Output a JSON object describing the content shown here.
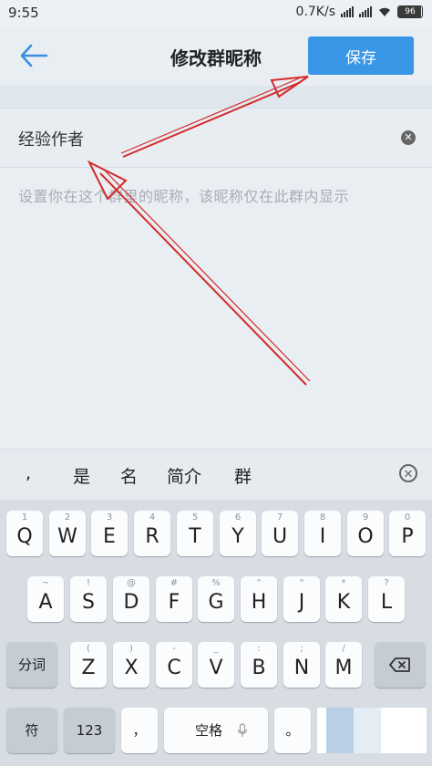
{
  "status_bar": {
    "time": "9:55",
    "network_speed": "0.7K/s",
    "battery": "96"
  },
  "header": {
    "title": "修改群昵称",
    "save_label": "保存"
  },
  "nickname_field": {
    "value": "经验作者"
  },
  "hint": "设置你在这个群里的昵称，该昵称仅在此群内显示",
  "candidates": [
    ",",
    "是",
    "名",
    "简介",
    "群"
  ],
  "keyboard": {
    "row1": [
      {
        "sub": "1",
        "main": "Q"
      },
      {
        "sub": "2",
        "main": "W"
      },
      {
        "sub": "3",
        "main": "E"
      },
      {
        "sub": "4",
        "main": "R"
      },
      {
        "sub": "5",
        "main": "T"
      },
      {
        "sub": "6",
        "main": "Y"
      },
      {
        "sub": "7",
        "main": "U"
      },
      {
        "sub": "8",
        "main": "I"
      },
      {
        "sub": "9",
        "main": "O"
      },
      {
        "sub": "0",
        "main": "P"
      }
    ],
    "row2": [
      {
        "sub": "~",
        "main": "A"
      },
      {
        "sub": "!",
        "main": "S"
      },
      {
        "sub": "@",
        "main": "D"
      },
      {
        "sub": "#",
        "main": "F"
      },
      {
        "sub": "%",
        "main": "G"
      },
      {
        "sub": "\"",
        "main": "H"
      },
      {
        "sub": "\"",
        "main": "J"
      },
      {
        "sub": "*",
        "main": "K"
      },
      {
        "sub": "?",
        "main": "L"
      }
    ],
    "row3_left": "分词",
    "row3": [
      {
        "sub": "(",
        "main": "Z"
      },
      {
        "sub": ")",
        "main": "X"
      },
      {
        "sub": "-",
        "main": "C"
      },
      {
        "sub": "_",
        "main": "V"
      },
      {
        "sub": ":",
        "main": "B"
      },
      {
        "sub": ";",
        "main": "N"
      },
      {
        "sub": "/",
        "main": "M"
      }
    ],
    "row4": {
      "symbols": "符",
      "numbers": "123",
      "comma": "，",
      "space": "空格",
      "period": "。"
    }
  },
  "colors": {
    "accent": "#3a96e6",
    "arrow": "#d42a2a"
  }
}
